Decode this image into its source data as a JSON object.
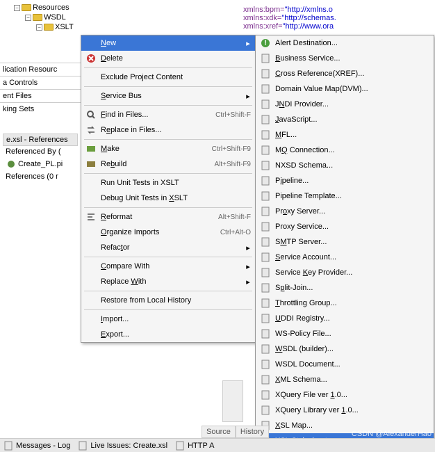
{
  "code_lines": [
    {
      "attr": "xmlns:bpm=",
      "val": "\"http://xmlns.o"
    },
    {
      "attr": "xmlns:xdk=",
      "val": "\"http://schemas."
    },
    {
      "attr": "xmlns:xref=",
      "val": "\"http://www.ora"
    }
  ],
  "tree": {
    "root": "Resources",
    "children": [
      "WSDL",
      "XSLT"
    ]
  },
  "sidebar": [
    "lication Resourc",
    "a Controls",
    "ent Files",
    "king Sets"
  ],
  "ref_panel": {
    "title": "e.xsl - References",
    "lines": [
      "Referenced By (",
      "Create_PL.pi",
      "References (0 r"
    ]
  },
  "menu1": [
    {
      "label": "New",
      "u": 0,
      "arrow": true,
      "selected": true
    },
    {
      "label": "Delete",
      "u": 0,
      "icon": "delete"
    },
    "sep",
    {
      "label": "Exclude Project Content"
    },
    "sep",
    {
      "label": "Service Bus",
      "u": 0,
      "arrow": true
    },
    "sep",
    {
      "label": "Find in Files...",
      "u": 0,
      "icon": "find",
      "shortcut": "Ctrl+Shift-F"
    },
    {
      "label": "Replace in Files...",
      "u": 1,
      "icon": "replace"
    },
    "sep",
    {
      "label": "Make",
      "u": 0,
      "icon": "make",
      "shortcut": "Ctrl+Shift-F9"
    },
    {
      "label": "Rebuild",
      "u": 2,
      "icon": "rebuild",
      "shortcut": "Alt+Shift-F9"
    },
    "sep",
    {
      "label": "Run Unit Tests in XSLT"
    },
    {
      "label": "Debug Unit Tests in XSLT",
      "u": 20
    },
    "sep",
    {
      "label": "Reformat",
      "u": 0,
      "icon": "reformat",
      "shortcut": "Alt+Shift-F"
    },
    {
      "label": "Organize Imports",
      "u": 0,
      "shortcut": "Ctrl+Alt-O"
    },
    {
      "label": "Refactor",
      "u": 5,
      "arrow": true
    },
    "sep",
    {
      "label": "Compare With",
      "u": 0,
      "arrow": true
    },
    {
      "label": "Replace With",
      "u": 8,
      "arrow": true
    },
    "sep",
    {
      "label": "Restore from Local History"
    },
    "sep",
    {
      "label": "Import...",
      "u": 0
    },
    {
      "label": "Export...",
      "u": 0
    }
  ],
  "menu2": [
    {
      "label": "Alert Destination...",
      "icon": "alert"
    },
    {
      "label": "Business Service...",
      "u": 0,
      "icon": "biz"
    },
    {
      "label": "Cross Reference(XREF)...",
      "u": 0,
      "icon": "xref"
    },
    {
      "label": "Domain Value Map(DVM)...",
      "icon": "dvm"
    },
    {
      "label": "JNDI Provider...",
      "u": 1,
      "icon": "jndi"
    },
    {
      "label": "JavaScript...",
      "u": 0,
      "icon": "js"
    },
    {
      "label": "MFL...",
      "u": 0,
      "icon": "mfl"
    },
    {
      "label": "MQ Connection...",
      "u": 1,
      "icon": "mq"
    },
    {
      "label": "NXSD Schema...",
      "icon": "nxsd"
    },
    {
      "label": "Pipeline...",
      "u": 1,
      "icon": "pipe"
    },
    {
      "label": "Pipeline Template...",
      "icon": "pipet"
    },
    {
      "label": "Proxy Server...",
      "u": 2,
      "icon": "pserv"
    },
    {
      "label": "Proxy Service...",
      "icon": "psvc"
    },
    {
      "label": "SMTP Server...",
      "u": 1,
      "icon": "smtp"
    },
    {
      "label": "Service Account...",
      "u": 0,
      "icon": "sacc"
    },
    {
      "label": "Service Key Provider...",
      "u": 8,
      "icon": "skey"
    },
    {
      "label": "Split-Join...",
      "u": 1,
      "icon": "split"
    },
    {
      "label": "Throttling Group...",
      "u": 0,
      "icon": "thr"
    },
    {
      "label": "UDDI Registry...",
      "u": 0,
      "icon": "uddi"
    },
    {
      "label": "WS-Policy File...",
      "icon": "wspol"
    },
    {
      "label": "WSDL (builder)...",
      "u": 0,
      "icon": "wsdlb"
    },
    {
      "label": "WSDL Document...",
      "icon": "wsdld"
    },
    {
      "label": "XML Schema...",
      "u": 0,
      "icon": "xmls"
    },
    {
      "label": "XQuery File ver 1.0...",
      "u": 16,
      "icon": "xqf"
    },
    {
      "label": "XQuery Library ver 1.0...",
      "u": 19,
      "icon": "xql"
    },
    {
      "label": "XSL Map...",
      "u": 0,
      "icon": "xslm"
    },
    {
      "label": "XSL Stylesheet...",
      "icon": "xsls",
      "selected": true
    }
  ],
  "bottom_tabs": [
    "Source",
    "History"
  ],
  "bottom_bar": [
    "Messages - Log",
    "Live Issues: Create.xsl",
    "HTTP A"
  ],
  "watermark": "CSDN @AlexanderHao"
}
